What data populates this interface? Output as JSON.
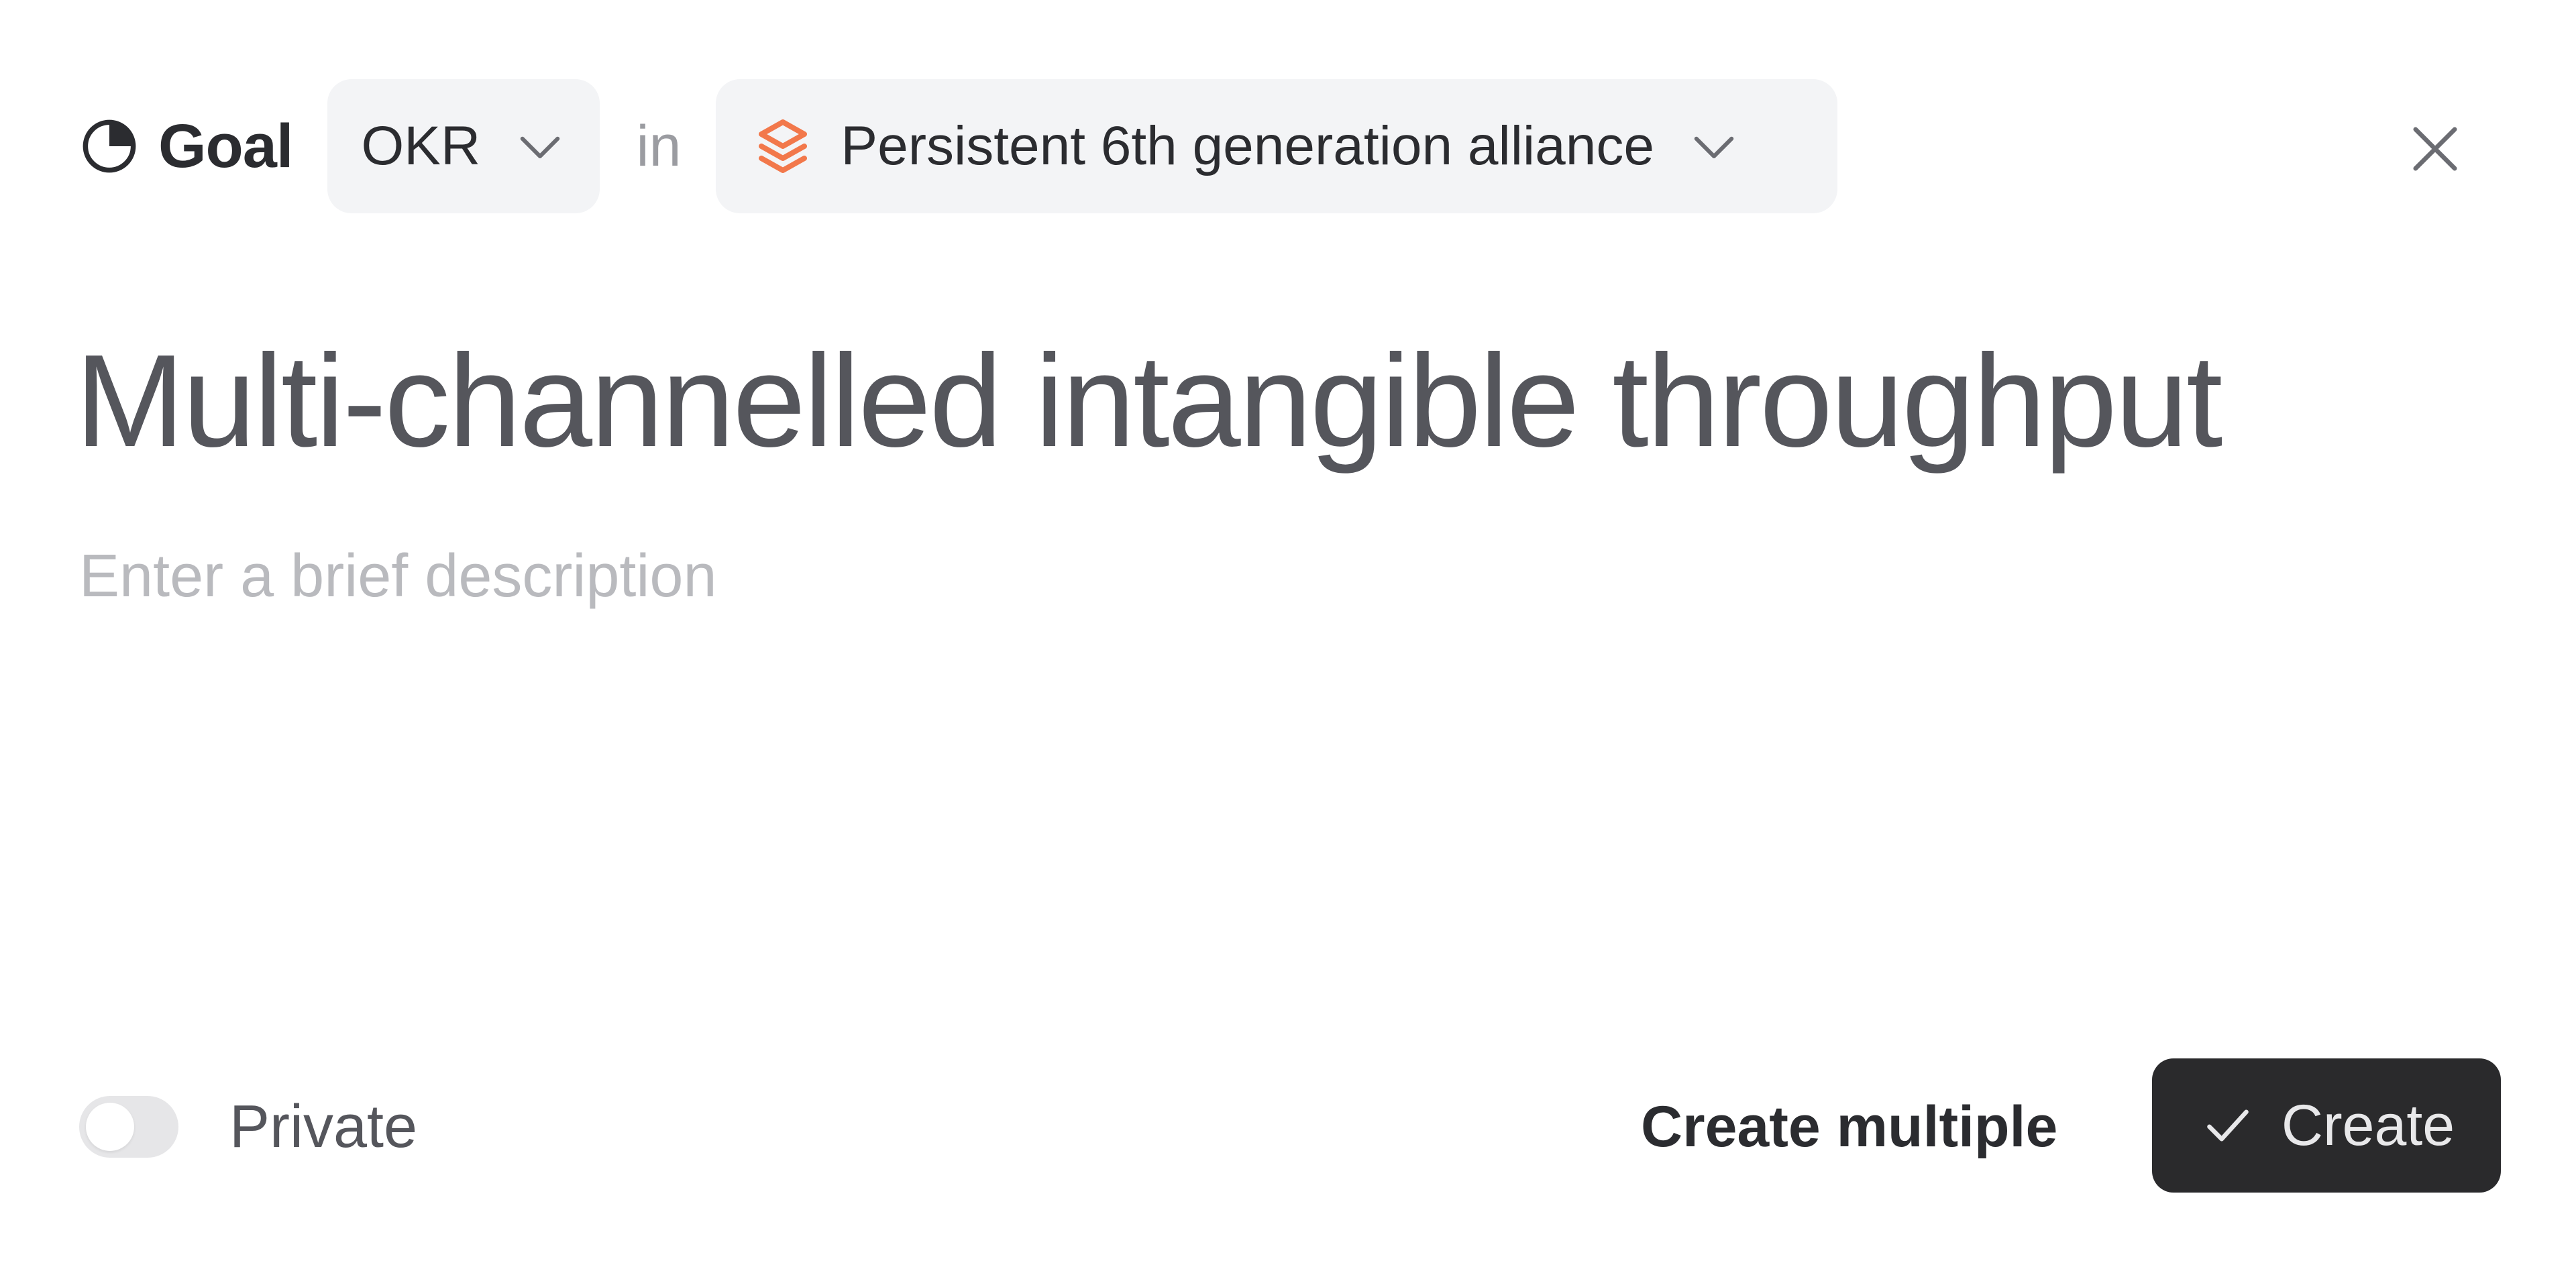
{
  "header": {
    "type_label": "Goal",
    "type_icon": "goal-pie-icon",
    "category": {
      "label": "OKR",
      "icon": "chevron-down-icon"
    },
    "connector": "in",
    "project": {
      "label": "Persistent 6th generation alliance",
      "icon": "stack-layers-icon",
      "icon_color": "#f2784b",
      "chevron": "chevron-down-icon"
    },
    "close_icon": "close-icon"
  },
  "title": "Multi-channelled intangible throughput",
  "description": {
    "value": "",
    "placeholder": "Enter a brief description"
  },
  "footer": {
    "private_label": "Private",
    "private_enabled": false,
    "create_multiple_label": "Create multiple",
    "create_label": "Create",
    "create_icon": "check-icon"
  },
  "colors": {
    "accent_orange": "#f2784b",
    "primary_button_bg": "#2a2a2c",
    "pill_bg": "#f3f4f6"
  }
}
